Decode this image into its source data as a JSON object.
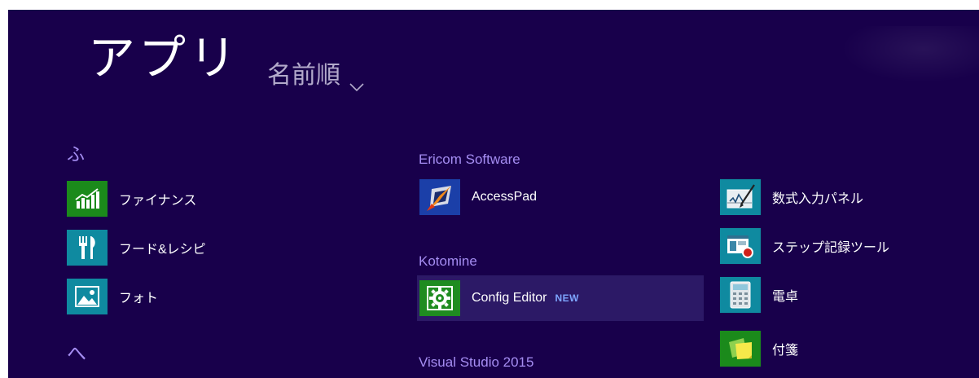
{
  "header": {
    "title": "アプリ",
    "sort_label": "名前順",
    "sort_icon": "chevron-down-icon"
  },
  "columns": [
    {
      "groups": [
        {
          "header": "ふ",
          "apps": [
            {
              "label": "ファイナンス",
              "icon": "finance-chart-icon",
              "tile_color": "#1b8a1b"
            },
            {
              "label": "フード&レシピ",
              "icon": "fork-knife-icon",
              "tile_color": "#0f8aa0"
            },
            {
              "label": "フォト",
              "icon": "photo-icon",
              "tile_color": "#0f8aa0"
            }
          ]
        },
        {
          "header": "へ",
          "apps": []
        }
      ]
    },
    {
      "groups": [
        {
          "header": "Ericom Software",
          "apps": [
            {
              "label": "AccessPad",
              "icon": "accesspad-icon",
              "tile_color": "#1b3fa8"
            }
          ]
        },
        {
          "header": "Kotomine",
          "apps": [
            {
              "label": "Config Editor",
              "badge": "NEW",
              "icon": "gear-icon",
              "tile_color": "#1f8c20",
              "selected": true
            }
          ]
        },
        {
          "header": "Visual Studio 2015",
          "apps": []
        }
      ]
    },
    {
      "groups": [
        {
          "header": "",
          "apps": [
            {
              "label": "数式入力パネル",
              "icon": "math-input-icon",
              "tile_color": "#0f8aa0"
            },
            {
              "label": "ステップ記録ツール",
              "icon": "steps-recorder-icon",
              "tile_color": "#0f8aa0"
            },
            {
              "label": "電卓",
              "icon": "calculator-icon",
              "tile_color": "#0f8aa0"
            },
            {
              "label": "付箋",
              "icon": "sticky-notes-icon",
              "tile_color": "#1b8a1b"
            }
          ]
        }
      ]
    }
  ],
  "colors": {
    "background": "#18004b",
    "group_header": "#a58df2",
    "selection": "#2c1966",
    "badge": "#7ea6ff"
  }
}
